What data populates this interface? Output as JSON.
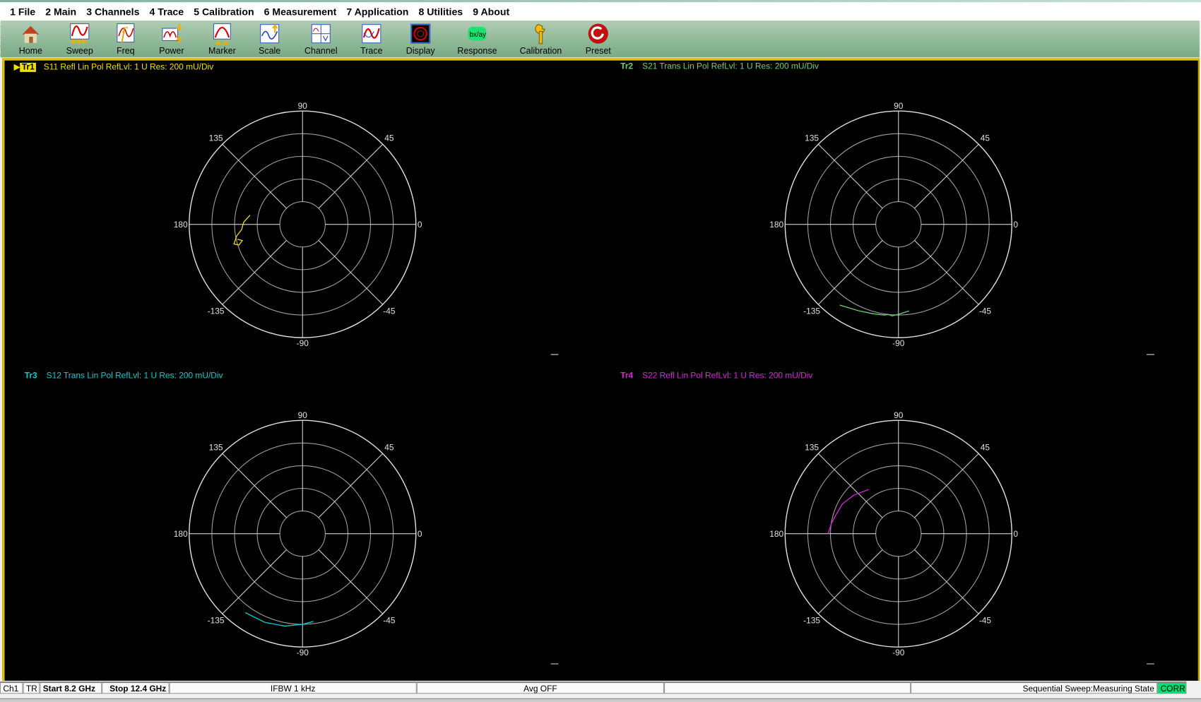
{
  "menu": [
    "1 File",
    "2 Main",
    "3 Channels",
    "4 Trace",
    "5 Calibration",
    "6 Measurement",
    "7 Application",
    "8 Utilities",
    "9 About"
  ],
  "toolbar": [
    {
      "label": "Home",
      "icon": "home-icon"
    },
    {
      "label": "Sweep",
      "icon": "sweep-icon"
    },
    {
      "label": "Freq",
      "icon": "freq-icon"
    },
    {
      "label": "Power",
      "icon": "power-icon"
    },
    {
      "label": "Marker",
      "icon": "marker-icon"
    },
    {
      "label": "Scale",
      "icon": "scale-icon"
    },
    {
      "label": "Channel",
      "icon": "channel-icon"
    },
    {
      "label": "Trace",
      "icon": "trace-icon"
    },
    {
      "label": "Display",
      "icon": "display-icon"
    },
    {
      "label": "Response",
      "icon": "response-icon"
    },
    {
      "label": "Calibration",
      "icon": "calibration-icon"
    },
    {
      "label": "Preset",
      "icon": "preset-icon"
    }
  ],
  "traces": [
    {
      "id": "Tr1",
      "active": true,
      "desc": "S11 Refl Lin Pol RefLvl: 1  U Res: 200 mU/Div",
      "color": "#f0e000",
      "points": [
        [
          0.47,
          170
        ],
        [
          0.52,
          178
        ],
        [
          0.54,
          185
        ],
        [
          0.59,
          190
        ],
        [
          0.63,
          196
        ],
        [
          0.59,
          198
        ],
        [
          0.55,
          195
        ],
        [
          0.59,
          193
        ]
      ]
    },
    {
      "id": "Tr2",
      "active": false,
      "desc": "S21 Trans Lin Pol RefLvl: 1  U Res: 200 mU/Div",
      "color": "#70d070",
      "points": [
        [
          0.88,
          -126
        ],
        [
          0.84,
          -115
        ],
        [
          0.82,
          -106
        ],
        [
          0.81,
          -99
        ],
        [
          0.8,
          -96
        ],
        [
          0.81,
          -94
        ],
        [
          0.79,
          -89
        ],
        [
          0.77,
          -83
        ]
      ]
    },
    {
      "id": "Tr3",
      "active": false,
      "desc": "S12 Trans Lin Pol RefLvl: 1  U Res: 200 mU/Div",
      "color": "#00d0d0",
      "points": [
        [
          0.86,
          -126
        ],
        [
          0.85,
          -113
        ],
        [
          0.83,
          -101
        ],
        [
          0.81,
          -95
        ],
        [
          0.8,
          -90
        ],
        [
          0.78,
          -83
        ]
      ]
    },
    {
      "id": "Tr4",
      "active": false,
      "desc": "S22 Refl Lin Pol RefLvl: 1  U Res: 200 mU/Div",
      "color": "#e020e0",
      "points": [
        [
          0.62,
          180
        ],
        [
          0.6,
          172
        ],
        [
          0.58,
          165
        ],
        [
          0.56,
          152
        ],
        [
          0.52,
          139
        ],
        [
          0.47,
          124
        ]
      ]
    }
  ],
  "angle_labels": [
    "90",
    "45",
    "0",
    "-45",
    "-90",
    "-135",
    "180",
    "135"
  ],
  "status": {
    "channel": "Ch1",
    "mode": "TR",
    "start": "Start 8.2 GHz",
    "stop": "Stop 12.4 GHz",
    "ifbw": "IFBW 1 kHz",
    "avg": "Avg OFF",
    "blank": "",
    "state": "Sequential Sweep:Measuring State",
    "corr": "CORR"
  },
  "colors": {
    "accent": "#e0c000",
    "corr": "#00e070",
    "grid": "#c8c8c8"
  }
}
